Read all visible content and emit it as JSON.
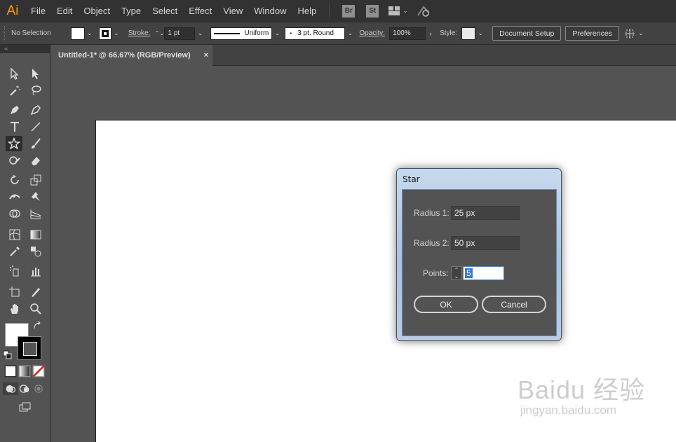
{
  "app": {
    "logo": "Ai",
    "menu": [
      "File",
      "Edit",
      "Object",
      "Type",
      "Select",
      "Effect",
      "View",
      "Window",
      "Help"
    ],
    "bridge_badge": "Br",
    "stock_badge": "St"
  },
  "control_bar": {
    "selection": "No Selection",
    "stroke_label": "Stroke:",
    "stroke_weight": "1 pt",
    "stroke_profile": "Uniform",
    "brush": "3 pt. Round",
    "opacity_label": "Opacity:",
    "opacity_value": "100%",
    "style_label": "Style:",
    "document_setup": "Document Setup",
    "preferences": "Preferences"
  },
  "tools_panel": {
    "collapse": "‹‹",
    "active_tool": "star"
  },
  "document": {
    "tab_title": "Untitled-1* @ 66.67% (RGB/Preview)",
    "close": "×"
  },
  "dialog": {
    "title": "Star",
    "radius1_label": "Radius 1:",
    "radius1_value": "25 px",
    "radius2_label": "Radius 2:",
    "radius2_value": "50 px",
    "points_label": "Points:",
    "points_value": "5",
    "ok": "OK",
    "cancel": "Cancel"
  },
  "watermark": {
    "logo": "Baidu 经验",
    "url": "jingyan.baidu.com"
  },
  "colors": {
    "ui_dark": "#323232",
    "ui_mid": "#535353",
    "ai_orange": "#ff9a00",
    "selection_blue": "#3a78d0"
  }
}
